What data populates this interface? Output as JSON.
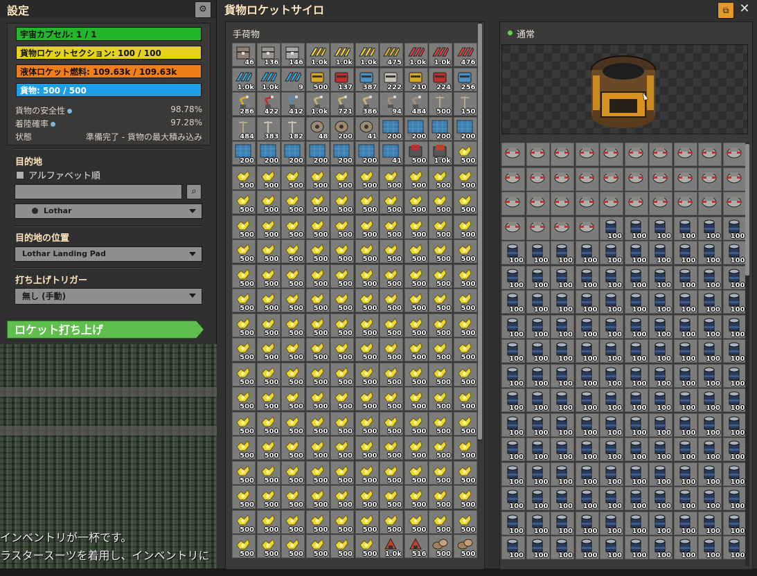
{
  "settings": {
    "title": "設定",
    "bars": [
      {
        "label": "宇宙カプセル: 1 / 1",
        "color": "#23b52b",
        "fill": 1.0,
        "white": false
      },
      {
        "label": "貨物ロケットセクション: 100 / 100",
        "color": "#e5d21a",
        "fill": 1.0,
        "white": false
      },
      {
        "label": "液体ロケット燃料: 109.63k / 109.63k",
        "color": "#f07d18",
        "fill": 1.0,
        "white": false
      },
      {
        "label": "貨物: 500 / 500",
        "color": "#1d9fe5",
        "fill": 1.0,
        "white": true
      }
    ],
    "stats": [
      {
        "label": "貨物の安全性",
        "value": "98.78%",
        "info": true
      },
      {
        "label": "着陸確率",
        "value": "97.28%",
        "info": true
      },
      {
        "label": "状態",
        "value": "準備完了 - 貨物の最大積み込み",
        "info": false
      }
    ],
    "destination_heading": "目的地",
    "alphabetical_label": "アルファベット順",
    "search_placeholder": "",
    "planet": "Lothar",
    "location_heading": "目的地の位置",
    "location": "Lothar Landing Pad",
    "trigger_heading": "打ち上げトリガー",
    "trigger": "無し (手動)",
    "launch_button": "ロケット打ち上げ"
  },
  "messages": [
    "インベントリが一杯です。",
    "ラスタースーツを着用し、インベントリに"
  ],
  "silo": {
    "title": "貨物ロケットサイロ",
    "inventory_heading": "手荷物",
    "status": "通常"
  },
  "icon_colors": {
    "chest": "#8c8074",
    "gear": "#a5a099",
    "arrow_yellow": "#f2d23a",
    "arrow_blue": "#3aa8e0",
    "arrow_red": "#e04040",
    "splitter_yellow": "#d4a62a",
    "splitter_blue": "#4a8fc0",
    "splitter_red": "#b83030",
    "inserter": "#c8b070",
    "pole": "#b8a890",
    "tank": "#9a8a70",
    "tile": "#3d7fb0",
    "yellow_item": "#ecd832",
    "robot": "#b0aea8",
    "can": "#aab4c0",
    "rocket": "#c04030",
    "rock": "#a08060"
  },
  "inventory": [
    {
      "icon": "chest-icon",
      "color": "#8c8074",
      "count": "46"
    },
    {
      "icon": "chest-icon",
      "color": "#9a9490",
      "count": "136"
    },
    {
      "icon": "chest-icon",
      "color": "#a8a8a8",
      "count": "146"
    },
    {
      "icon": "belt-icon",
      "color": "#f2d23a",
      "count": "1.0k"
    },
    {
      "icon": "belt-icon",
      "color": "#f2d23a",
      "count": "1.0k"
    },
    {
      "icon": "belt-icon",
      "color": "#f2d23a",
      "count": "1.0k"
    },
    {
      "icon": "belt-icon",
      "color": "#e0b030",
      "count": "475"
    },
    {
      "icon": "belt-icon",
      "color": "#e04040",
      "count": "1.0k"
    },
    {
      "icon": "belt-icon",
      "color": "#e04040",
      "count": "1.0k"
    },
    {
      "icon": "belt-icon",
      "color": "#e04040",
      "count": "476"
    },
    {
      "icon": "belt-icon",
      "color": "#3aa8e0",
      "count": "1.0k"
    },
    {
      "icon": "belt-icon",
      "color": "#3aa8e0",
      "count": "1.0k"
    },
    {
      "icon": "belt-icon",
      "color": "#3aa8e0",
      "count": "9"
    },
    {
      "icon": "splitter-icon",
      "color": "#d4a62a",
      "count": "500"
    },
    {
      "icon": "splitter-icon",
      "color": "#b83030",
      "count": "137"
    },
    {
      "icon": "splitter-icon",
      "color": "#4a8fc0",
      "count": "387"
    },
    {
      "icon": "splitter-icon",
      "color": "#c8c0b0",
      "count": "222"
    },
    {
      "icon": "splitter-icon",
      "color": "#d4a62a",
      "count": "210"
    },
    {
      "icon": "splitter-icon",
      "color": "#b83030",
      "count": "224"
    },
    {
      "icon": "splitter-icon",
      "color": "#4a8fc0",
      "count": "256"
    },
    {
      "icon": "inserter-icon",
      "color": "#d4a62a",
      "count": "286"
    },
    {
      "icon": "inserter-icon",
      "color": "#b83030",
      "count": "422"
    },
    {
      "icon": "inserter-icon",
      "color": "#4a8fc0",
      "count": "412"
    },
    {
      "icon": "inserter-icon",
      "color": "#c8b070",
      "count": "1.0k"
    },
    {
      "icon": "inserter-icon",
      "color": "#c8b070",
      "count": "721"
    },
    {
      "icon": "inserter-icon",
      "color": "#c8b070",
      "count": "386"
    },
    {
      "icon": "inserter-icon",
      "color": "#a09080",
      "count": "94"
    },
    {
      "icon": "inserter-icon",
      "color": "#a09080",
      "count": "484"
    },
    {
      "icon": "pole-icon",
      "color": "#b8a890",
      "count": "500"
    },
    {
      "icon": "pole-icon",
      "color": "#b8a890",
      "count": "150"
    },
    {
      "icon": "pole-icon",
      "color": "#b8a890",
      "count": "484"
    },
    {
      "icon": "pole-icon",
      "color": "#c8c0b0",
      "count": "383"
    },
    {
      "icon": "pole-icon",
      "color": "#c8c0b0",
      "count": "182"
    },
    {
      "icon": "tank-icon",
      "color": "#9a8a70",
      "count": "48"
    },
    {
      "icon": "tank-icon",
      "color": "#9a8a70",
      "count": "200"
    },
    {
      "icon": "tank-icon",
      "color": "#9a8a70",
      "count": "41"
    },
    {
      "icon": "tile-icon",
      "color": "#3d7fb0",
      "count": "200"
    },
    {
      "icon": "tile-icon",
      "color": "#3d7fb0",
      "count": "200"
    },
    {
      "icon": "tile-icon",
      "color": "#3d7fb0",
      "count": "200"
    },
    {
      "icon": "tile-icon",
      "color": "#3d7fb0",
      "count": "200"
    },
    {
      "icon": "tile-icon",
      "color": "#3d7fb0",
      "count": "200"
    },
    {
      "icon": "tile-icon",
      "color": "#3d7fb0",
      "count": "200"
    },
    {
      "icon": "tile-icon",
      "color": "#3d7fb0",
      "count": "200"
    },
    {
      "icon": "tile-icon",
      "color": "#3d7fb0",
      "count": "200"
    },
    {
      "icon": "tile-icon",
      "color": "#3d7fb0",
      "count": "200"
    },
    {
      "icon": "tile-icon",
      "color": "#3d7fb0",
      "count": "200"
    },
    {
      "icon": "tile-icon",
      "color": "#3d7fb0",
      "count": "41"
    },
    {
      "icon": "machine-icon",
      "color": "#b83030",
      "count": "500"
    },
    {
      "icon": "machine-icon",
      "color": "#c04030",
      "count": "1.0k"
    },
    {
      "icon": "ore-icon",
      "color": "#ecd832",
      "count": "500"
    }
  ],
  "inventory_fill": {
    "icon": "ore-icon",
    "color": "#ecd832",
    "count": "500",
    "rows_of_ten": 15
  },
  "inventory_last_row": [
    {
      "icon": "ore-icon",
      "color": "#ecd832",
      "count": "500"
    },
    {
      "icon": "ore-icon",
      "color": "#ecd832",
      "count": "500"
    },
    {
      "icon": "ore-icon",
      "color": "#ecd832",
      "count": "500"
    },
    {
      "icon": "ore-icon",
      "color": "#ecd832",
      "count": "500"
    },
    {
      "icon": "ore-icon",
      "color": "#ecd832",
      "count": "500"
    },
    {
      "icon": "ore-icon",
      "color": "#ecd832",
      "count": "500"
    },
    {
      "icon": "rocket-icon",
      "color": "#c04030",
      "count": "1.0k"
    },
    {
      "icon": "rocket-icon",
      "color": "#c04030",
      "count": "516"
    },
    {
      "icon": "rock-icon",
      "color": "#a08060",
      "count": "500"
    },
    {
      "icon": "rock-icon",
      "color": "#a08060",
      "count": "500"
    }
  ],
  "cargo": {
    "robot_count": 34,
    "robot_icon": "robot-icon",
    "can_icon": "can-icon",
    "can_count_label": "100",
    "can_slots": 136
  }
}
